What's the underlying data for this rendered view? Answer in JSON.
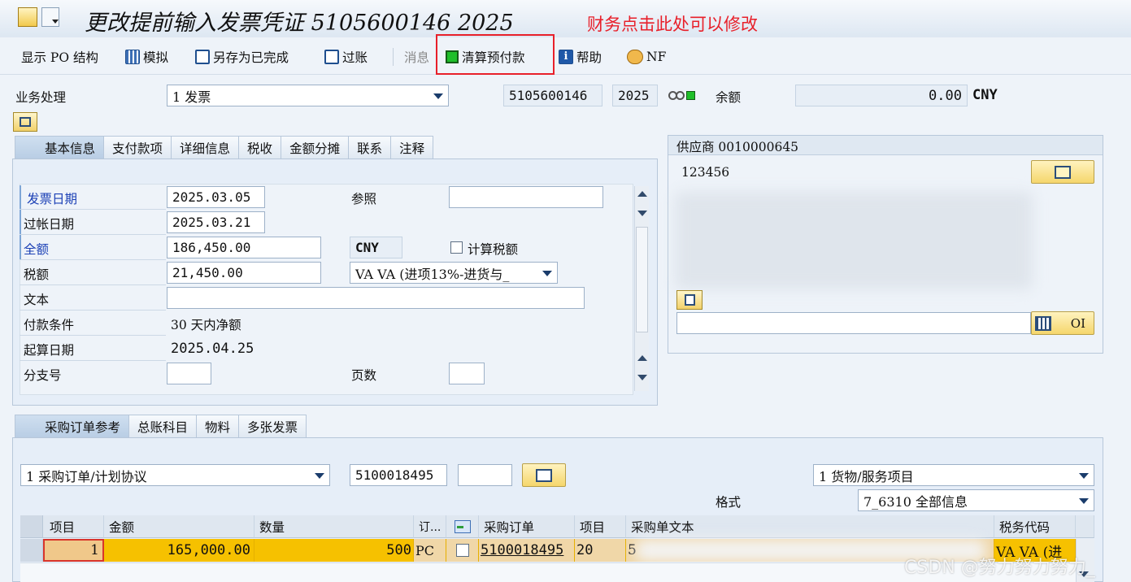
{
  "window": {
    "title": "更改提前输入发票凭证 5105600146 2025"
  },
  "annotation": "财务点击此处可以修改",
  "toolbar": {
    "show_po_structure": "显示 PO 结构",
    "simulate": "模拟",
    "save_as_complete": "另存为已完成",
    "post": "过账",
    "messages": "消息",
    "clear_prepayment": "清算预付款",
    "help": "帮助",
    "nf": "NF"
  },
  "transaction": {
    "label": "业务处理",
    "value": "1 发票",
    "doc_number": "5105600146",
    "year": "2025",
    "balance_label": "余额",
    "balance_value": "0.00",
    "currency": "CNY"
  },
  "header_tabs": [
    "基本信息",
    "支付款项",
    "详细信息",
    "税收",
    "金额分摊",
    "联系",
    "注释"
  ],
  "basic": {
    "invoice_date_label": "发票日期",
    "invoice_date": "2025.03.05",
    "reference_label": "参照",
    "reference": "",
    "posting_date_label": "过帐日期",
    "posting_date": "2025.03.21",
    "amount_label": "全额",
    "amount": "186,450.00",
    "amount_currency": "CNY",
    "calc_tax_label": "计算税额",
    "tax_label": "税额",
    "tax": "21,450.00",
    "tax_code": "VA VA (进项13%-进货与_",
    "text_label": "文本",
    "text": "",
    "payment_terms_label": "付款条件",
    "payment_terms": "30 天内净额",
    "baseline_label": "起算日期",
    "baseline_date": "2025.04.25",
    "branch_label": "分支号",
    "branch": "",
    "pages_label": "页数",
    "pages": ""
  },
  "vendor": {
    "title": "供应商 0010000645",
    "name": "123456",
    "oi_button": "OI"
  },
  "po_tabs": [
    "采购订单参考",
    "总账科目",
    "物料",
    "多张发票"
  ],
  "po_ref": {
    "ref_type": "1 采购订单/计划协议",
    "po_number": "5100018495",
    "extra": "",
    "item_type": "1 货物/服务项目",
    "format_label": "格式",
    "format": "7_6310 全部信息"
  },
  "grid": {
    "columns": [
      "项目",
      "金额",
      "数量",
      "订...",
      "采购订单",
      "项目",
      "采购单文本",
      "税务代码"
    ],
    "rows": [
      {
        "item": "1",
        "amount": "165,000.00",
        "quantity": "500",
        "unit": "PC",
        "po": "5100018495",
        "po_item": "20",
        "text": "5",
        "tax_code": "VA VA (进"
      }
    ]
  },
  "watermark": "CSDN @努力努力努力_"
}
